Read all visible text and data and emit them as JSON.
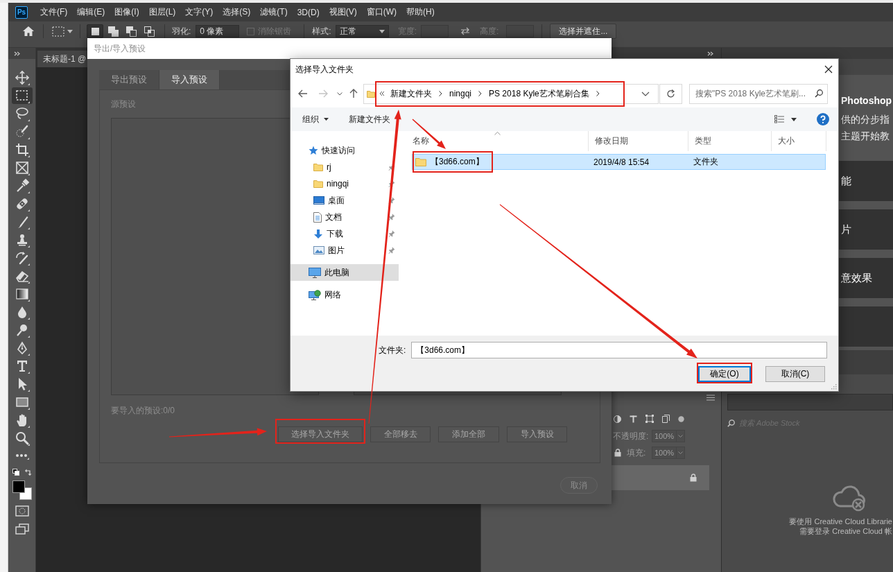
{
  "menu_bar": {
    "app_logo": "Ps",
    "items": [
      "文件(F)",
      "编辑(E)",
      "图像(I)",
      "图层(L)",
      "文字(Y)",
      "选择(S)",
      "滤镜(T)",
      "3D(D)",
      "视图(V)",
      "窗口(W)",
      "帮助(H)"
    ]
  },
  "options_bar": {
    "modes": [
      {
        "kind": "new",
        "selected": true
      },
      {
        "kind": "add",
        "selected": false
      },
      {
        "kind": "subtract",
        "selected": false
      },
      {
        "kind": "intersect",
        "selected": false
      }
    ],
    "feather": {
      "label": "羽化:",
      "value": "0 像素"
    },
    "anti_alias": {
      "label": "消除锯齿",
      "checked": false,
      "disabled": true
    },
    "style": {
      "label": "样式:",
      "value": "正常"
    },
    "width": {
      "label": "宽度:",
      "disabled": true
    },
    "height": {
      "label": "高度:",
      "disabled": true
    },
    "refine_button": "选择并遮住..."
  },
  "tools": [
    {
      "kind": "move",
      "selected": false
    },
    {
      "kind": "marquee",
      "selected": true
    },
    {
      "kind": "lasso",
      "selected": false
    },
    {
      "kind": "quick_select",
      "selected": false
    },
    {
      "kind": "crop",
      "selected": false
    },
    {
      "kind": "frame",
      "selected": false
    },
    {
      "kind": "eyedropper",
      "selected": false
    },
    {
      "kind": "healing",
      "selected": false
    },
    {
      "kind": "brush",
      "selected": false
    },
    {
      "kind": "stamp",
      "selected": false
    },
    {
      "kind": "history_brush",
      "selected": false
    },
    {
      "kind": "eraser",
      "selected": false
    },
    {
      "kind": "gradient",
      "selected": false
    },
    {
      "kind": "blur",
      "selected": false
    },
    {
      "kind": "dodge",
      "selected": false
    },
    {
      "kind": "pen",
      "selected": false
    },
    {
      "kind": "type",
      "selected": false
    },
    {
      "kind": "path_select",
      "selected": false
    },
    {
      "kind": "rectangle",
      "selected": false
    },
    {
      "kind": "hand",
      "selected": false
    },
    {
      "kind": "zoom",
      "selected": false
    },
    {
      "kind": "more",
      "selected": false
    }
  ],
  "color_swatches": [
    {
      "kind": "foreground",
      "color": "#000000"
    },
    {
      "kind": "background",
      "color": "#ffffff"
    }
  ],
  "document_tab": "未标题-1 @",
  "preset_dialog": {
    "title": "导出/导入预设",
    "tabs": [
      {
        "label": "导出预设",
        "selected": false
      },
      {
        "label": "导入预设",
        "selected": true
      }
    ],
    "source_label": "源预设",
    "count_label": "要导入的预设:0/0",
    "buttons": [
      {
        "label": "选择导入文件夹",
        "annotated": true
      },
      {
        "label": "全部移去",
        "annotated": false
      },
      {
        "label": "添加全部",
        "annotated": false
      },
      {
        "label": "导入预设",
        "annotated": false
      }
    ],
    "cancel": "取消"
  },
  "file_dialog": {
    "title": "选择导入文件夹",
    "address": {
      "crumbs": [
        "新建文件夹",
        "ningqi",
        "PS 2018 Kyle艺术笔刷合集"
      ],
      "annotated": true
    },
    "search_placeholder": "搜索\"PS 2018 Kyle艺术笔刷...",
    "organize": "组织",
    "new_folder": "新建文件夹",
    "nav": [
      {
        "label": "快速访问",
        "kind": "quick_access",
        "selected": false,
        "children": [
          {
            "label": "rj",
            "kind": "folder",
            "pinned": true,
            "selected": false
          },
          {
            "label": "ningqi",
            "kind": "folder",
            "pinned": true,
            "selected": false
          },
          {
            "label": "桌面",
            "kind": "desktop",
            "pinned": true,
            "selected": false
          },
          {
            "label": "文档",
            "kind": "documents",
            "pinned": true,
            "selected": false
          },
          {
            "label": "下载",
            "kind": "downloads",
            "pinned": true,
            "selected": false
          },
          {
            "label": "图片",
            "kind": "pictures",
            "pinned": true,
            "selected": false
          }
        ]
      },
      {
        "label": "此电脑",
        "kind": "computer",
        "selected": true
      },
      {
        "label": "网络",
        "kind": "network",
        "selected": false
      }
    ],
    "columns": [
      {
        "label": "名称",
        "sorted": true
      },
      {
        "label": "修改日期",
        "sorted": false
      },
      {
        "label": "类型",
        "sorted": false
      },
      {
        "label": "大小",
        "sorted": false
      }
    ],
    "rows": [
      {
        "name": "【3d66.com】",
        "modified": "2019/4/8 15:54",
        "type": "文件夹",
        "selected": true,
        "annotated": true
      }
    ],
    "folder_field": {
      "label": "文件夹:",
      "value": "【3d66.com】"
    },
    "buttons": [
      {
        "label": "确定(O)",
        "default": true,
        "annotated": true
      },
      {
        "label": "取消(C)",
        "default": false,
        "annotated": false
      }
    ]
  },
  "layers_panel": {
    "opacity": {
      "label": "不透明度:",
      "value": "100%",
      "disabled": true
    },
    "fill": {
      "label": "填充:",
      "value": "100%",
      "disabled": true
    },
    "layers": [
      {
        "locked": true,
        "selected": true
      }
    ]
  },
  "learn_panel": {
    "title": "Photoshop",
    "description_lines": [
      "供的分步指",
      "主题开始教"
    ],
    "cards": [
      "能",
      "片",
      "意效果"
    ]
  },
  "libraries_panel": {
    "search_placeholder": "搜索 Adobe Stock",
    "message_lines": [
      "要使用 Creative Cloud Librarie",
      "需要登录 Creative Cloud 帐"
    ]
  }
}
